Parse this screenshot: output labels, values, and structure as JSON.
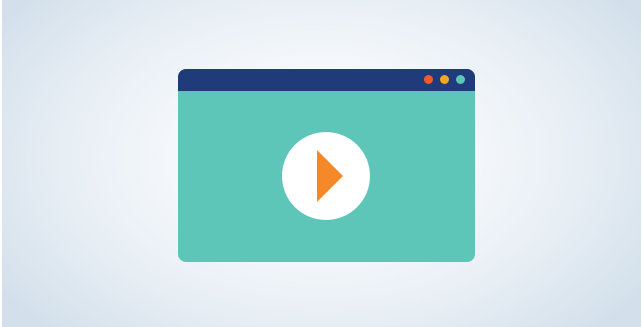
{
  "player": {
    "window_dots": [
      {
        "name": "close",
        "color": "#f15a2b"
      },
      {
        "name": "minimize",
        "color": "#f5a623"
      },
      {
        "name": "maximize",
        "color": "#5ec6b9"
      }
    ],
    "play_button": {
      "icon": "play-icon",
      "icon_color": "#f5892a",
      "background": "#ffffff"
    },
    "colors": {
      "titlebar": "#1f3b7a",
      "content": "#5ec6b9"
    }
  }
}
